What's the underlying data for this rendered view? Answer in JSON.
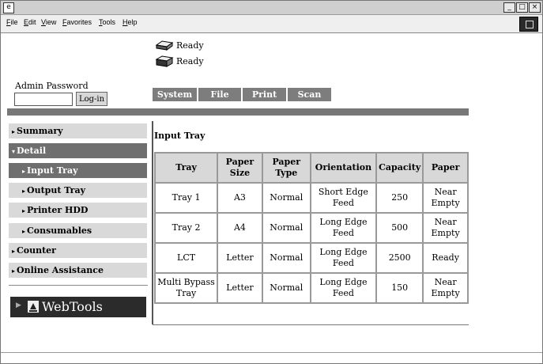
{
  "menubar": {
    "items": [
      "File",
      "Edit",
      "View",
      "Favorites",
      "Tools",
      "Help"
    ]
  },
  "status": [
    {
      "label": "Ready",
      "icon": "printer-icon"
    },
    {
      "label": "Ready",
      "icon": "scanner-icon"
    }
  ],
  "login": {
    "admin_label": "Admin Password",
    "button": "Log-in",
    "value": ""
  },
  "tabs": [
    "System",
    "File",
    "Print",
    "Scan"
  ],
  "sidebar": {
    "items": [
      {
        "label": "Summary",
        "arrow": "▸"
      },
      {
        "label": "Detail",
        "arrow": "▾"
      },
      {
        "label": "Input Tray",
        "arrow": "▸"
      },
      {
        "label": "Output Tray",
        "arrow": "▸"
      },
      {
        "label": "Printer HDD",
        "arrow": "▸"
      },
      {
        "label": "Consumables",
        "arrow": "▸"
      },
      {
        "label": "Counter",
        "arrow": "▸"
      },
      {
        "label": "Online Assistance",
        "arrow": "▸"
      }
    ],
    "webtools": "WebTools"
  },
  "main": {
    "title": "Input Tray",
    "table": {
      "headers": [
        "Tray",
        "Paper Size",
        "Paper Type",
        "Orientation",
        "Capacity",
        "Paper"
      ],
      "rows": [
        [
          "Tray 1",
          "A3",
          "Normal",
          "Short Edge Feed",
          "250",
          "Near Empty"
        ],
        [
          "Tray 2",
          "A4",
          "Normal",
          "Long Edge Feed",
          "500",
          "Near Empty"
        ],
        [
          "LCT",
          "Letter",
          "Normal",
          "Long Edge Feed",
          "2500",
          "Ready"
        ],
        [
          "Multi Bypass Tray",
          "Letter",
          "Normal",
          "Long Edge Feed",
          "150",
          "Near Empty"
        ]
      ]
    }
  }
}
